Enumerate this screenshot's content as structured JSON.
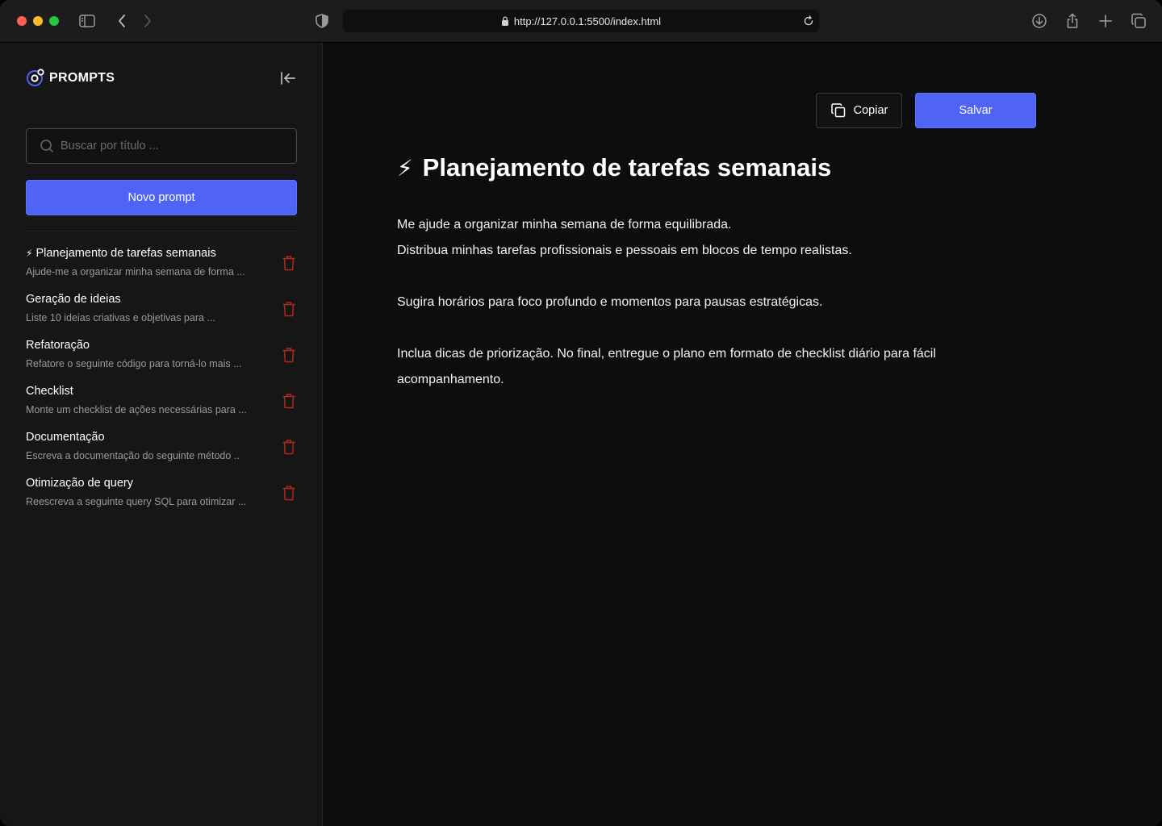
{
  "browser": {
    "url": "http://127.0.0.1:5500/index.html"
  },
  "sidebar": {
    "logo_text": "PROMPTS",
    "search_placeholder": "Buscar por título ...",
    "new_button": "Novo prompt",
    "items": [
      {
        "icon": "⚡",
        "title": "Planejamento de tarefas semanais",
        "desc": "Ajude-me a organizar minha semana de forma ..."
      },
      {
        "icon": "",
        "title": "Geração de ideias",
        "desc": "Liste 10 ideias criativas e objetivas para ..."
      },
      {
        "icon": "",
        "title": "Refatoração",
        "desc": "Refatore o seguinte código para torná-lo mais ..."
      },
      {
        "icon": "",
        "title": "Checklist",
        "desc": "Monte um checklist de ações necessárias para ..."
      },
      {
        "icon": "",
        "title": "Documentação",
        "desc": "Escreva a documentação do seguinte método .."
      },
      {
        "icon": "",
        "title": "Otimização de query",
        "desc": "Reescreva a seguinte query SQL para otimizar ..."
      }
    ]
  },
  "main": {
    "copy_button": "Copiar",
    "save_button": "Salvar",
    "title_icon": "⚡",
    "title": "Planejamento de tarefas semanais",
    "body_lines": [
      "Me ajude a organizar minha semana de forma equilibrada.",
      "Distribua minhas tarefas profissionais e pessoais em blocos de tempo realistas.",
      "",
      "Sugira horários para foco profundo e momentos para pausas estratégicas.",
      "",
      "Inclua dicas de priorização. No final, entregue o plano em formato de checklist diário para fácil acompanhamento."
    ]
  },
  "colors": {
    "accent": "#4f63f5",
    "trash": "#b3261e",
    "sidebar_bg": "#161616",
    "main_bg": "#0d0d0d"
  },
  "icons": [
    "sidebar-toggle-icon",
    "back-icon",
    "forward-icon",
    "shield-icon",
    "lock-icon",
    "reload-icon",
    "download-icon",
    "share-icon",
    "new-tab-icon",
    "tabs-icon",
    "logo-icon",
    "collapse-icon",
    "search-icon",
    "trash-icon",
    "copy-icon",
    "bolt-icon"
  ]
}
